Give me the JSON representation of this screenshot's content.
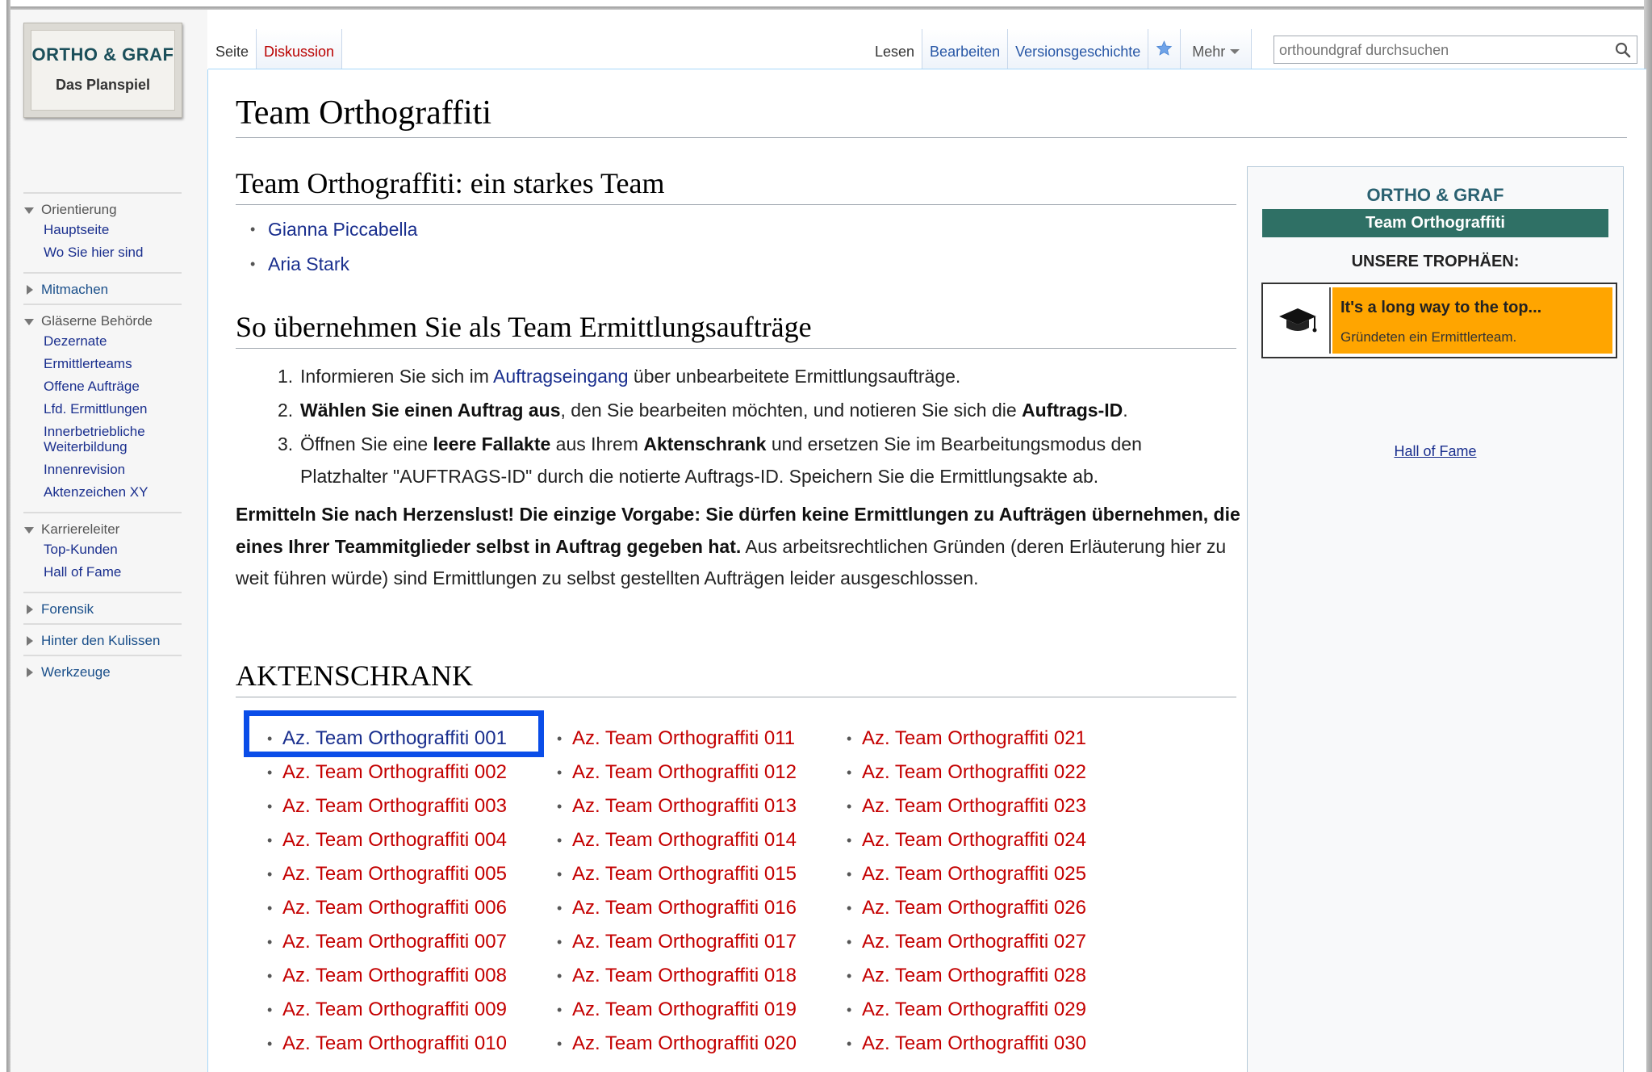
{
  "logo": {
    "title": "ORTHO & GRAF",
    "subtitle": "Das Planspiel"
  },
  "sidebar": {
    "portals": [
      {
        "label": "Orientierung",
        "expanded": true,
        "items": [
          "Hauptseite",
          "Wo Sie hier sind"
        ]
      },
      {
        "label": "Mitmachen",
        "expanded": false,
        "items": []
      },
      {
        "label": "Gläserne Behörde",
        "expanded": true,
        "items": [
          "Dezernate",
          "Ermittlerteams",
          "Offene Aufträge",
          "Lfd. Ermittlungen",
          "Innerbetriebliche Weiterbildung",
          "Innenrevision",
          "Aktenzeichen XY"
        ]
      },
      {
        "label": "Karriereleiter",
        "expanded": true,
        "items": [
          "Top-Kunden",
          "Hall of Fame"
        ]
      },
      {
        "label": "Forensik",
        "expanded": false,
        "items": []
      },
      {
        "label": "Hinter den Kulissen",
        "expanded": false,
        "items": []
      },
      {
        "label": "Werkzeuge",
        "expanded": false,
        "items": []
      }
    ]
  },
  "tabs": {
    "namespaces": [
      "Seite",
      "Diskussion"
    ],
    "views": [
      "Lesen",
      "Bearbeiten",
      "Versionsgeschichte"
    ],
    "more": "Mehr"
  },
  "search": {
    "placeholder": "orthoundgraf durchsuchen"
  },
  "page": {
    "title": "Team Orthograffiti",
    "section1": "Team Orthograffiti: ein starkes Team",
    "members": [
      "Gianna Piccabella",
      "Aria Stark"
    ],
    "section2": "So übernehmen Sie als Team Ermittlungsaufträge",
    "steps": {
      "s1_pre": "Informieren Sie sich im ",
      "s1_link": "Auftragseingang",
      "s1_post": " über unbearbeitete Ermittlungsaufträge.",
      "s2_bold": "Wählen Sie einen Auftrag aus",
      "s2_mid": ", den Sie bearbeiten möchten, und notieren Sie sich die ",
      "s2_bold2": "Auftrags-ID",
      "s2_end": ".",
      "s3_a": "Öffnen Sie eine ",
      "s3_b": "leere Fallakte",
      "s3_c": " aus Ihrem ",
      "s3_d": "Aktenschrank",
      "s3_e": " und ersetzen Sie im Bearbeitungsmodus den Platzhalter \"AUFTRAGS-ID\" durch die notierte Auftrags-ID. Speichern Sie die Ermittlungsakte ab."
    },
    "para_bold": "Ermitteln Sie nach Herzenslust! Die einzige Vorgabe: Sie dürfen keine Ermittlungen zu Aufträgen übernehmen, die eines Ihrer Teammitglieder selbst in Auftrag gegeben hat.",
    "para_rest": " Aus arbeitsrechtlichen Gründen (deren Erläuterung hier zu weit führen würde) sind Ermittlungen zu selbst gestellten Aufträgen leider ausgeschlossen.",
    "section3": "AKTENSCHRANK",
    "files": [
      "Az. Team Orthograffiti 001",
      "Az. Team Orthograffiti 002",
      "Az. Team Orthograffiti 003",
      "Az. Team Orthograffiti 004",
      "Az. Team Orthograffiti 005",
      "Az. Team Orthograffiti 006",
      "Az. Team Orthograffiti 007",
      "Az. Team Orthograffiti 008",
      "Az. Team Orthograffiti 009",
      "Az. Team Orthograffiti 010",
      "Az. Team Orthograffiti 011",
      "Az. Team Orthograffiti 012",
      "Az. Team Orthograffiti 013",
      "Az. Team Orthograffiti 014",
      "Az. Team Orthograffiti 015",
      "Az. Team Orthograffiti 016",
      "Az. Team Orthograffiti 017",
      "Az. Team Orthograffiti 018",
      "Az. Team Orthograffiti 019",
      "Az. Team Orthograffiti 020",
      "Az. Team Orthograffiti 021",
      "Az. Team Orthograffiti 022",
      "Az. Team Orthograffiti 023",
      "Az. Team Orthograffiti 024",
      "Az. Team Orthograffiti 025",
      "Az. Team Orthograffiti 026",
      "Az. Team Orthograffiti 027",
      "Az. Team Orthograffiti 028",
      "Az. Team Orthograffiti 029",
      "Az. Team Orthograffiti 030"
    ]
  },
  "infobox": {
    "title": "ORTHO & GRAF",
    "team": "Team Orthograffiti",
    "trophies_heading": "UNSERE TROPHÄEN:",
    "trophy": {
      "name": "It's a long way to the top...",
      "description": "Gründeten ein Ermittlerteam."
    },
    "hall_of_fame": "Hall of Fame"
  },
  "colors": {
    "link": "#1a2f8e",
    "new_link": "#c40000",
    "accent_teal": "#2f7065",
    "trophy_orange": "#ffa500",
    "highlight": "#0a4de8"
  }
}
